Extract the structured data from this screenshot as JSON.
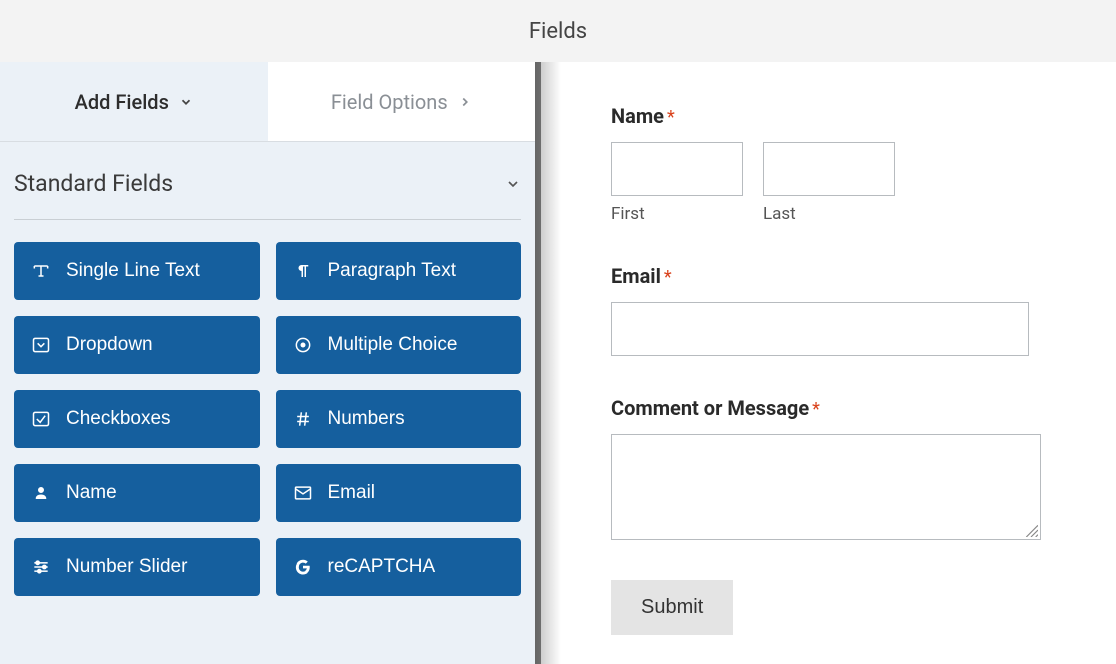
{
  "header": {
    "title": "Fields"
  },
  "tabs": {
    "add_fields": "Add Fields",
    "field_options": "Field Options"
  },
  "section": {
    "title": "Standard Fields"
  },
  "field_buttons": [
    {
      "icon": "text-type",
      "label": "Single Line Text"
    },
    {
      "icon": "paragraph",
      "label": "Paragraph Text"
    },
    {
      "icon": "caret-square",
      "label": "Dropdown"
    },
    {
      "icon": "radio-dot",
      "label": "Multiple Choice"
    },
    {
      "icon": "check-square",
      "label": "Checkboxes"
    },
    {
      "icon": "hash",
      "label": "Numbers"
    },
    {
      "icon": "user",
      "label": "Name"
    },
    {
      "icon": "envelope",
      "label": "Email"
    },
    {
      "icon": "sliders",
      "label": "Number Slider"
    },
    {
      "icon": "google-g",
      "label": "reCAPTCHA"
    }
  ],
  "preview": {
    "name_label": "Name",
    "first_sublabel": "First",
    "last_sublabel": "Last",
    "email_label": "Email",
    "comment_label": "Comment or Message",
    "submit_label": "Submit",
    "required_marker": "*"
  }
}
